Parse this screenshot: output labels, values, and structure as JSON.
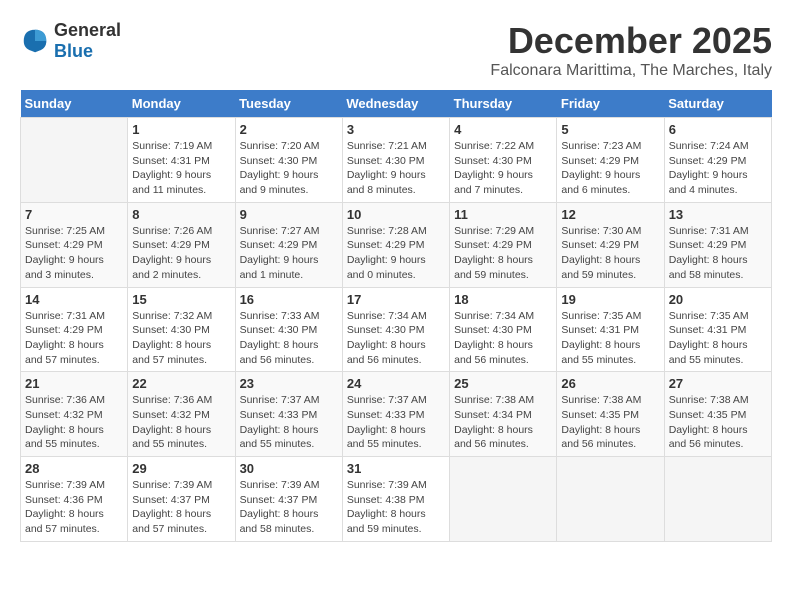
{
  "header": {
    "logo_general": "General",
    "logo_blue": "Blue",
    "month_title": "December 2025",
    "location": "Falconara Marittima, The Marches, Italy"
  },
  "weekdays": [
    "Sunday",
    "Monday",
    "Tuesday",
    "Wednesday",
    "Thursday",
    "Friday",
    "Saturday"
  ],
  "weeks": [
    [
      {
        "day": "",
        "info": ""
      },
      {
        "day": "1",
        "info": "Sunrise: 7:19 AM\nSunset: 4:31 PM\nDaylight: 9 hours\nand 11 minutes."
      },
      {
        "day": "2",
        "info": "Sunrise: 7:20 AM\nSunset: 4:30 PM\nDaylight: 9 hours\nand 9 minutes."
      },
      {
        "day": "3",
        "info": "Sunrise: 7:21 AM\nSunset: 4:30 PM\nDaylight: 9 hours\nand 8 minutes."
      },
      {
        "day": "4",
        "info": "Sunrise: 7:22 AM\nSunset: 4:30 PM\nDaylight: 9 hours\nand 7 minutes."
      },
      {
        "day": "5",
        "info": "Sunrise: 7:23 AM\nSunset: 4:29 PM\nDaylight: 9 hours\nand 6 minutes."
      },
      {
        "day": "6",
        "info": "Sunrise: 7:24 AM\nSunset: 4:29 PM\nDaylight: 9 hours\nand 4 minutes."
      }
    ],
    [
      {
        "day": "7",
        "info": "Sunrise: 7:25 AM\nSunset: 4:29 PM\nDaylight: 9 hours\nand 3 minutes."
      },
      {
        "day": "8",
        "info": "Sunrise: 7:26 AM\nSunset: 4:29 PM\nDaylight: 9 hours\nand 2 minutes."
      },
      {
        "day": "9",
        "info": "Sunrise: 7:27 AM\nSunset: 4:29 PM\nDaylight: 9 hours\nand 1 minute."
      },
      {
        "day": "10",
        "info": "Sunrise: 7:28 AM\nSunset: 4:29 PM\nDaylight: 9 hours\nand 0 minutes."
      },
      {
        "day": "11",
        "info": "Sunrise: 7:29 AM\nSunset: 4:29 PM\nDaylight: 8 hours\nand 59 minutes."
      },
      {
        "day": "12",
        "info": "Sunrise: 7:30 AM\nSunset: 4:29 PM\nDaylight: 8 hours\nand 59 minutes."
      },
      {
        "day": "13",
        "info": "Sunrise: 7:31 AM\nSunset: 4:29 PM\nDaylight: 8 hours\nand 58 minutes."
      }
    ],
    [
      {
        "day": "14",
        "info": "Sunrise: 7:31 AM\nSunset: 4:29 PM\nDaylight: 8 hours\nand 57 minutes."
      },
      {
        "day": "15",
        "info": "Sunrise: 7:32 AM\nSunset: 4:30 PM\nDaylight: 8 hours\nand 57 minutes."
      },
      {
        "day": "16",
        "info": "Sunrise: 7:33 AM\nSunset: 4:30 PM\nDaylight: 8 hours\nand 56 minutes."
      },
      {
        "day": "17",
        "info": "Sunrise: 7:34 AM\nSunset: 4:30 PM\nDaylight: 8 hours\nand 56 minutes."
      },
      {
        "day": "18",
        "info": "Sunrise: 7:34 AM\nSunset: 4:30 PM\nDaylight: 8 hours\nand 56 minutes."
      },
      {
        "day": "19",
        "info": "Sunrise: 7:35 AM\nSunset: 4:31 PM\nDaylight: 8 hours\nand 55 minutes."
      },
      {
        "day": "20",
        "info": "Sunrise: 7:35 AM\nSunset: 4:31 PM\nDaylight: 8 hours\nand 55 minutes."
      }
    ],
    [
      {
        "day": "21",
        "info": "Sunrise: 7:36 AM\nSunset: 4:32 PM\nDaylight: 8 hours\nand 55 minutes."
      },
      {
        "day": "22",
        "info": "Sunrise: 7:36 AM\nSunset: 4:32 PM\nDaylight: 8 hours\nand 55 minutes."
      },
      {
        "day": "23",
        "info": "Sunrise: 7:37 AM\nSunset: 4:33 PM\nDaylight: 8 hours\nand 55 minutes."
      },
      {
        "day": "24",
        "info": "Sunrise: 7:37 AM\nSunset: 4:33 PM\nDaylight: 8 hours\nand 55 minutes."
      },
      {
        "day": "25",
        "info": "Sunrise: 7:38 AM\nSunset: 4:34 PM\nDaylight: 8 hours\nand 56 minutes."
      },
      {
        "day": "26",
        "info": "Sunrise: 7:38 AM\nSunset: 4:35 PM\nDaylight: 8 hours\nand 56 minutes."
      },
      {
        "day": "27",
        "info": "Sunrise: 7:38 AM\nSunset: 4:35 PM\nDaylight: 8 hours\nand 56 minutes."
      }
    ],
    [
      {
        "day": "28",
        "info": "Sunrise: 7:39 AM\nSunset: 4:36 PM\nDaylight: 8 hours\nand 57 minutes."
      },
      {
        "day": "29",
        "info": "Sunrise: 7:39 AM\nSunset: 4:37 PM\nDaylight: 8 hours\nand 57 minutes."
      },
      {
        "day": "30",
        "info": "Sunrise: 7:39 AM\nSunset: 4:37 PM\nDaylight: 8 hours\nand 58 minutes."
      },
      {
        "day": "31",
        "info": "Sunrise: 7:39 AM\nSunset: 4:38 PM\nDaylight: 8 hours\nand 59 minutes."
      },
      {
        "day": "",
        "info": ""
      },
      {
        "day": "",
        "info": ""
      },
      {
        "day": "",
        "info": ""
      }
    ]
  ]
}
